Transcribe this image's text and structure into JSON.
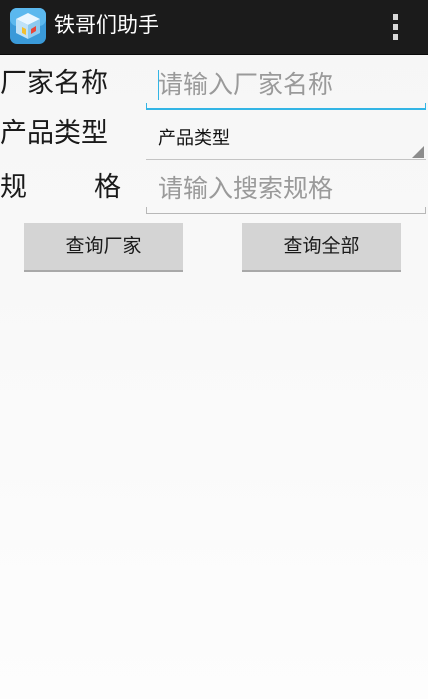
{
  "app": {
    "title": "铁哥们助手",
    "icon": "app-cube-icon",
    "menu_icon": "overflow-menu-icon"
  },
  "form": {
    "vendor": {
      "label": "厂家名称",
      "placeholder": "请输入厂家名称",
      "value": ""
    },
    "product_type": {
      "label": "产品类型",
      "selected": "产品类型"
    },
    "spec": {
      "label_part1": "规",
      "label_part2": "格",
      "placeholder": "请输入搜索规格",
      "value": ""
    }
  },
  "buttons": {
    "query_vendor": "查询厂家",
    "query_all": "查询全部"
  },
  "colors": {
    "actionbar": "#1b1b1b",
    "accent": "#33b5e5",
    "button_bg": "#d4d4d4"
  }
}
